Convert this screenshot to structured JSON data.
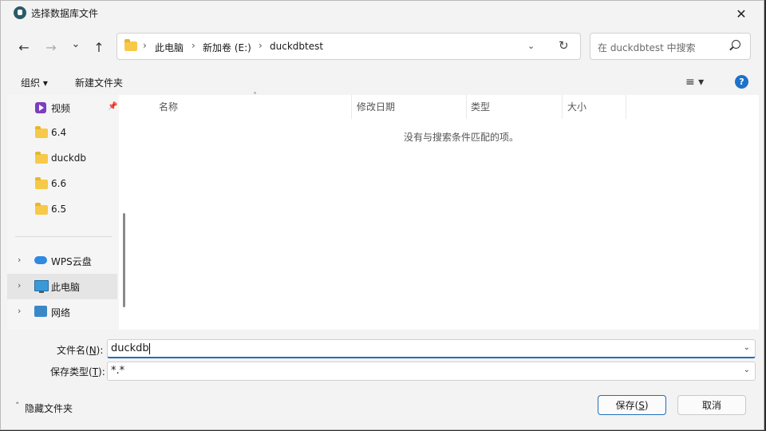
{
  "window": {
    "title": "选择数据库文件",
    "close_glyph": "✕"
  },
  "nav": {
    "back_glyph": "←",
    "forward_glyph": "→",
    "recent_glyph": "⌄",
    "up_glyph": "↑",
    "breadcrumb": [
      "此电脑",
      "新加卷 (E:)",
      "duckdbtest"
    ],
    "separator": "›",
    "address_dropdown_glyph": "⌄",
    "refresh_glyph": "↻",
    "search_placeholder": "在 duckdbtest 中搜索"
  },
  "toolbar": {
    "organize_label": "组织 ▾",
    "new_folder_label": "新建文件夹",
    "view_glyph": "≡ ▾",
    "help_glyph": "?"
  },
  "sidebar": {
    "items": [
      {
        "label": "视频",
        "icon": "video-icon",
        "pinned": true
      },
      {
        "label": "6.4",
        "icon": "folder-icon"
      },
      {
        "label": "duckdb",
        "icon": "folder-icon"
      },
      {
        "label": "6.6",
        "icon": "folder-icon"
      },
      {
        "label": "6.5",
        "icon": "folder-icon"
      },
      {
        "label": "WPS云盘",
        "icon": "cloud-icon",
        "expandable": true
      },
      {
        "label": "此电脑",
        "icon": "computer-icon",
        "expandable": true,
        "selected": true
      },
      {
        "label": "网络",
        "icon": "network-icon",
        "expandable": true
      }
    ],
    "pin_glyph": "📌",
    "expand_glyph": "›"
  },
  "columns": [
    "名称",
    "修改日期",
    "类型",
    "大小"
  ],
  "sort_glyph": "˄",
  "empty_message": "没有与搜索条件匹配的项。",
  "form": {
    "filename_label": "文件名(",
    "filename_key": "N",
    "filename_label_end": "):",
    "filename_value": "duckdb",
    "filetype_label": "保存类型(",
    "filetype_key": "T",
    "filetype_label_end": "):",
    "filetype_value": "*.*",
    "dropdown_glyph": "⌄"
  },
  "footer": {
    "hide_folders_label": "隐藏文件夹",
    "hide_folders_glyph": "˄",
    "save_label": "保存(",
    "save_key": "S",
    "save_label_end": ")",
    "cancel_label": "取消"
  }
}
